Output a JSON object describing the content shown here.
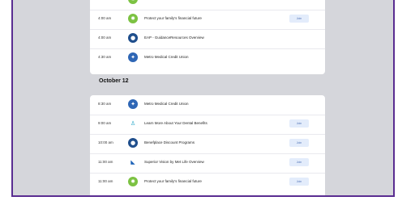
{
  "sections": [
    {
      "date": "",
      "events": [
        {
          "time": "",
          "title": "",
          "logo": "seal-green-icon",
          "join_label": ""
        },
        {
          "time": "4:00 am",
          "title": "Protect your family's financial future",
          "logo": "seal-green-icon",
          "join_label": "Join"
        },
        {
          "time": "4:00 am",
          "title": "EAP - GuidanceResources Overview",
          "logo": "globe-blue-icon",
          "join_label": ""
        },
        {
          "time": "4:30 am",
          "title": "Metro Medical Credit Union",
          "logo": "people-blue-icon",
          "join_label": ""
        }
      ]
    },
    {
      "date": "October 12",
      "events": [
        {
          "time": "8:30 am",
          "title": "Metro Medical Credit Union",
          "logo": "people-blue-icon",
          "join_label": ""
        },
        {
          "time": "9:00 am",
          "title": "Learn More About Your Dental Benefits",
          "logo": "tooth-person-icon",
          "join_label": "Join"
        },
        {
          "time": "10:00 am",
          "title": "Benefplace Discount Programs",
          "logo": "circle-blue-icon",
          "join_label": "Join"
        },
        {
          "time": "11:00 am",
          "title": "Superior Vision by Met Life Overview",
          "logo": "vision-logo-icon",
          "join_label": "Join"
        },
        {
          "time": "11:00 am",
          "title": "Protect your family's financial future",
          "logo": "seal-green-icon",
          "join_label": "Join"
        }
      ]
    }
  ],
  "colors": {
    "background": "#d5d6db",
    "frame_border": "#5a2d91",
    "join_bg": "#e3ecfb",
    "join_text": "#4d6fb3"
  }
}
